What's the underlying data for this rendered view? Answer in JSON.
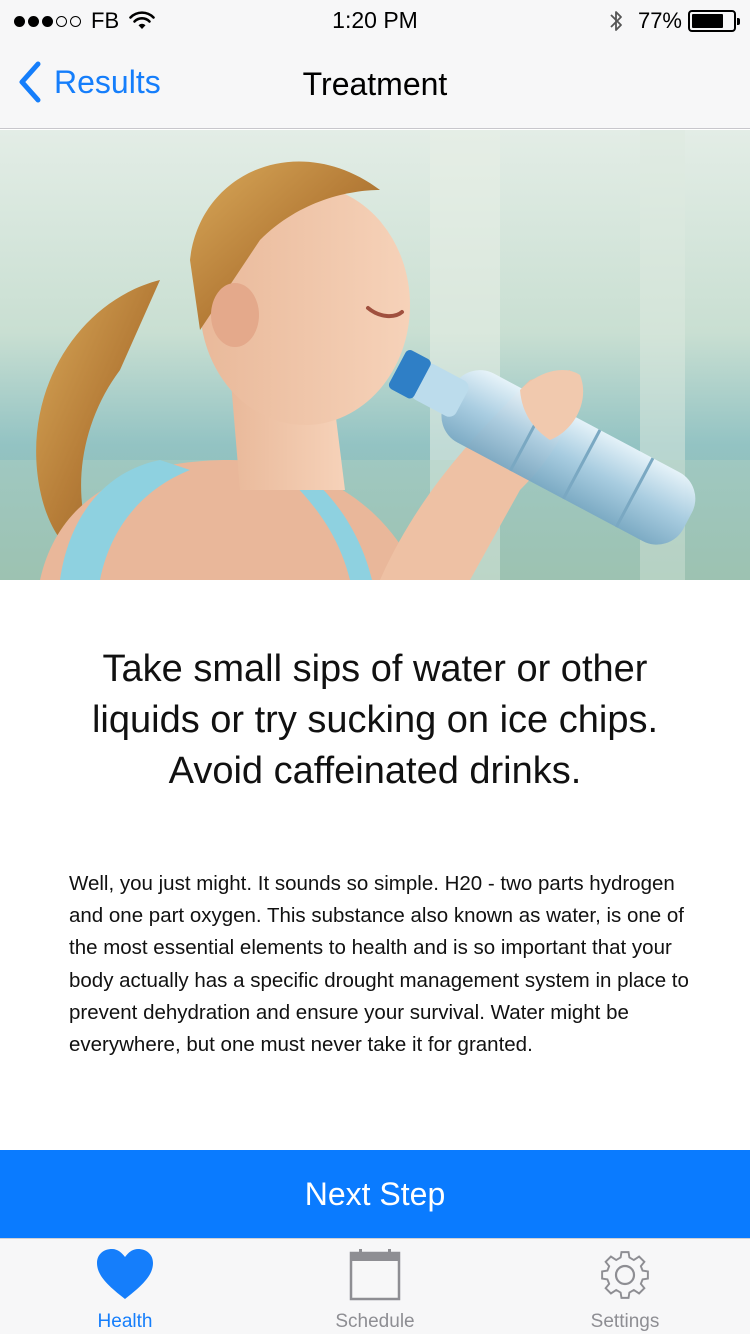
{
  "status_bar": {
    "carrier": "FB",
    "time": "1:20 PM",
    "battery_percent": "77%",
    "battery_level": 0.77,
    "signal_bars_filled": 3,
    "signal_bars_total": 5
  },
  "nav": {
    "back_label": "Results",
    "title": "Treatment"
  },
  "hero": {
    "image_subject": "woman-drinking-water-photo"
  },
  "content": {
    "headline": "Take small sips of water or other liquids or try sucking on ice chips. Avoid caffeinated drinks.",
    "body": "Well, you just might. It sounds so simple. H20 - two parts hydrogen and one part oxygen. This substance also known as water, is one of the most essential elements to health and is so important that your body actually has a specific drought management system in place to prevent dehydration and ensure your survival. Water might be everywhere, but one must never take it for granted."
  },
  "next_button": {
    "label": "Next Step"
  },
  "tab_bar": {
    "tabs": [
      {
        "label": "Health",
        "icon": "heart-icon",
        "active": true
      },
      {
        "label": "Schedule",
        "icon": "calendar-icon",
        "active": false
      },
      {
        "label": "Settings",
        "icon": "gear-icon",
        "active": false
      }
    ]
  },
  "colors": {
    "accent": "#157efb",
    "button_blue": "#0a7bff",
    "inactive_gray": "#8e8e93",
    "bar_background": "#f7f7f8"
  }
}
